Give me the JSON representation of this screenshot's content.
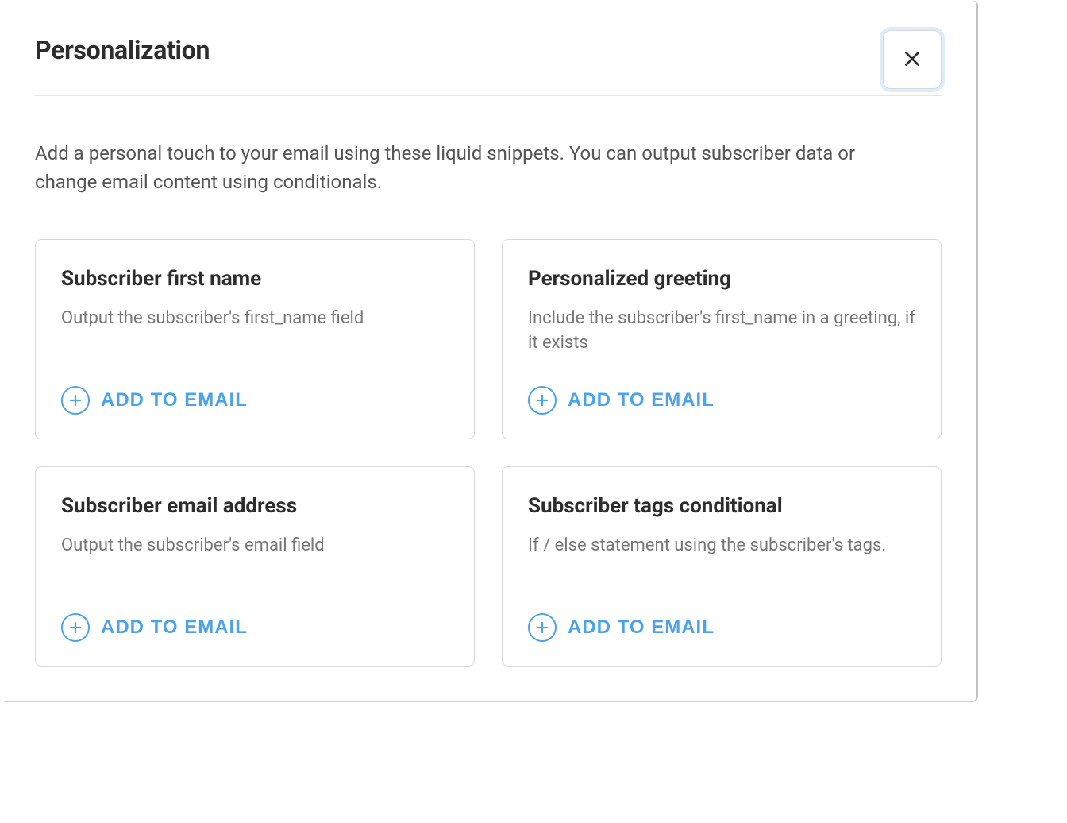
{
  "modal": {
    "title": "Personalization",
    "description": "Add a personal touch to your email using these liquid snippets. You can output subscriber data or change email content using conditionals.",
    "cards": [
      {
        "title": "Subscriber first name",
        "description": "Output the subscriber's first_name field",
        "button_label": "ADD TO EMAIL"
      },
      {
        "title": "Personalized greeting",
        "description": "Include the subscriber's first_name in a greeting, if it exists",
        "button_label": "ADD TO EMAIL"
      },
      {
        "title": "Subscriber email address",
        "description": "Output the subscriber's email field",
        "button_label": "ADD TO EMAIL"
      },
      {
        "title": "Subscriber tags conditional",
        "description": "If / else statement using the subscriber's tags.",
        "button_label": "ADD TO EMAIL"
      }
    ]
  }
}
